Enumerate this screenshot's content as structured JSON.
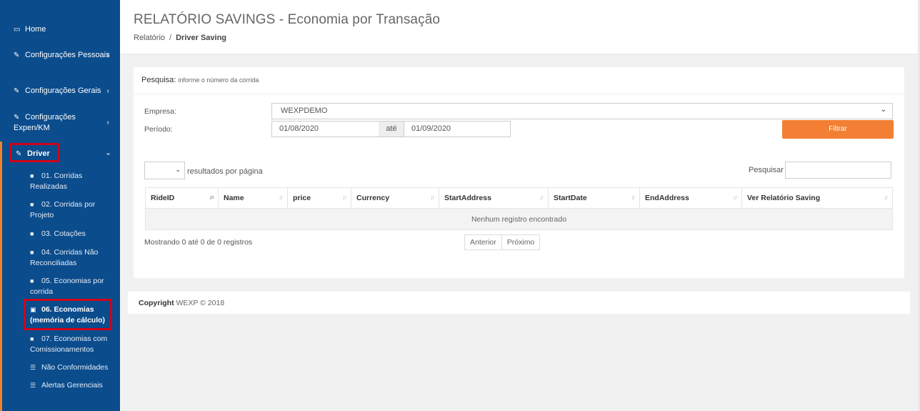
{
  "sidebar": {
    "home": "Home",
    "config_pessoais": "Configurações Pessoais",
    "config_gerais": "Configurações Gerais",
    "config_expen": "Configurações Expen/KM",
    "driver": "Driver",
    "submenu": [
      "01. Corridas Realizadas",
      "02. Corridas por Projeto",
      "03. Cotações",
      "04. Corridas Não Reconciliadas",
      "05. Economias por corrida",
      "06. Economias (memória de cálculo)",
      "07. Economias com Comissionamentos",
      "Não Conformidades",
      "Alertas Gerenciais"
    ],
    "highlight_color": "#d0021b",
    "bg_color": "#0b4c8c"
  },
  "header": {
    "title": "RELATÓRIO SAVINGS - Economia por Transação",
    "breadcrumb_root": "Relatório",
    "breadcrumb_sep": "/",
    "breadcrumb_current": "Driver Saving"
  },
  "search_panel": {
    "label": "Pesquisa:",
    "hint": "informe o número da corrida",
    "empresa_label": "Empresa:",
    "empresa_value": "WEXPDEMO",
    "periodo_label": "Período:",
    "date_from": "01/08/2020",
    "ate_label": "até",
    "date_to": "01/09/2020",
    "filter_button": "Filtrar",
    "accent_color": "#f27f34"
  },
  "table": {
    "length_label": "resultados por página",
    "search_label": "Pesquisar",
    "columns": [
      "RideID",
      "Name",
      "price",
      "Currency",
      "StartAddress",
      "StartDate",
      "EndAddress",
      "Ver Relatório Saving"
    ],
    "empty_message": "Nenhum registro encontrado",
    "info": "Mostrando 0 até 0 de 0 registros",
    "prev": "Anterior",
    "next": "Próximo"
  },
  "footer": {
    "copyright_label": "Copyright",
    "copyright_text": "WEXP © 2018"
  }
}
